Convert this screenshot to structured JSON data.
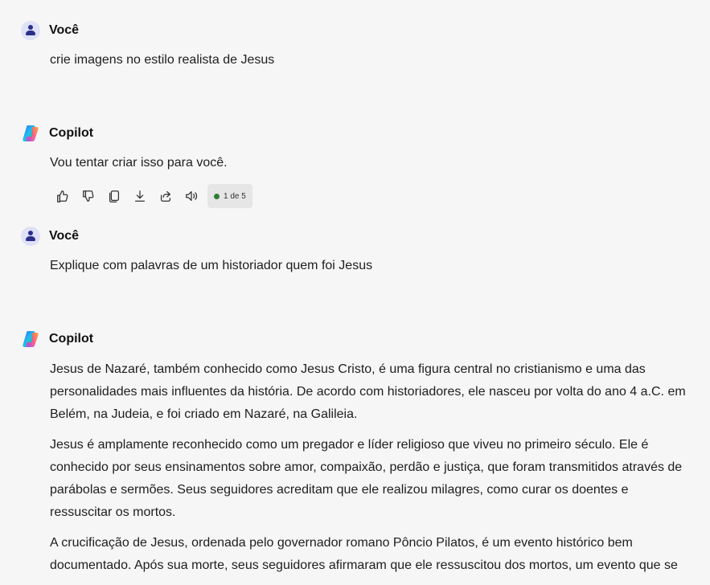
{
  "conversation": [
    {
      "author": "Você",
      "type": "user",
      "paragraphs": [
        "crie imagens no estilo realista de Jesus"
      ]
    },
    {
      "author": "Copilot",
      "type": "copilot",
      "paragraphs": [
        "Vou tentar criar isso para você."
      ],
      "actions": {
        "icons": [
          "thumbs-up-icon",
          "thumbs-down-icon",
          "copy-icon",
          "download-icon",
          "share-icon",
          "speaker-icon"
        ],
        "pager_text": "1 de 5",
        "pager_dot_color": "#2e7d32"
      }
    },
    {
      "author": "Você",
      "type": "user",
      "paragraphs": [
        "Explique com palavras de um historiador quem foi Jesus"
      ]
    },
    {
      "author": "Copilot",
      "type": "copilot",
      "paragraphs": [
        "Jesus de Nazaré, também conhecido como Jesus Cristo, é uma figura central no cristianismo e uma das personalidades mais influentes da história. De acordo com historiadores, ele nasceu por volta do ano 4 a.C. em Belém, na Judeia, e foi criado em Nazaré, na Galileia.",
        "Jesus é amplamente reconhecido como um pregador e líder religioso que viveu no primeiro século. Ele é conhecido por seus ensinamentos sobre amor, compaixão, perdão e justiça, que foram transmitidos através de parábolas e sermões. Seus seguidores acreditam que ele realizou milagres, como curar os doentes e ressuscitar os mortos.",
        "A crucificação de Jesus, ordenada pelo governador romano Pôncio Pilatos, é um evento histórico bem documentado. Após sua morte, seus seguidores afirmaram que ele ressuscitou dos mortos, um evento que se"
      ]
    }
  ]
}
